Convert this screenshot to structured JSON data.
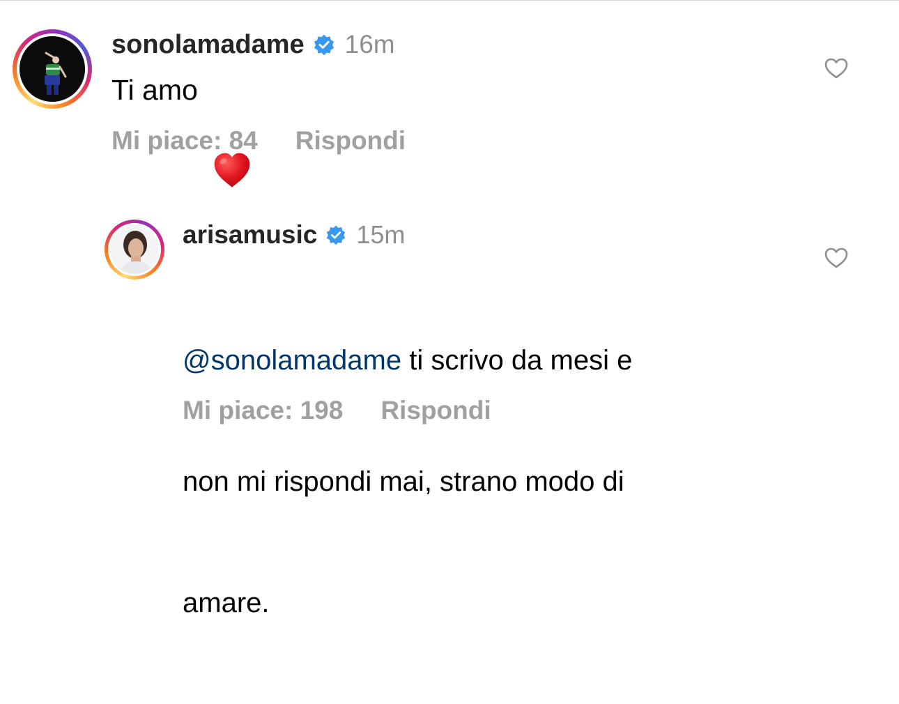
{
  "comments": [
    {
      "username": "sonolamadame",
      "verified": true,
      "time": "16m",
      "text": "Ti amo",
      "emoji": "heart-emoji",
      "likes_label": "Mi piace: 84",
      "reply_label": "Rispondi",
      "avatar": "sonolamadame-avatar"
    },
    {
      "username": "arisamusic",
      "verified": true,
      "time": "15m",
      "mention": "@sonolamadame",
      "text_line1": " ti scrivo da mesi e",
      "text_line2": "non mi rispondi mai, strano modo di",
      "text_line3": "amare.",
      "likes_label": "Mi piace: 198",
      "reply_label": "Rispondi",
      "avatar": "arisamusic-avatar"
    }
  ],
  "colors": {
    "verified_blue": "#3897f0",
    "mention_blue": "#00376b",
    "meta_gray": "#a0a0a0",
    "timestamp_gray": "#8e8e8e"
  }
}
